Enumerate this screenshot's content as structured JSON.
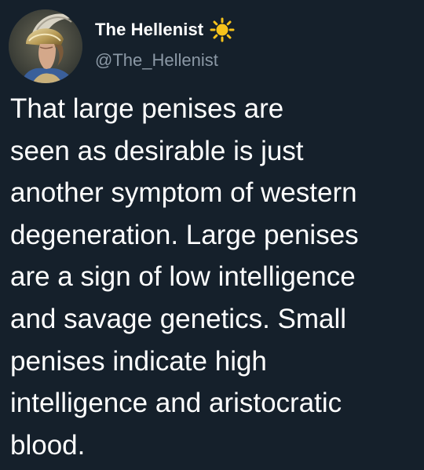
{
  "tweet": {
    "author": {
      "display_name": "The Hellenist",
      "handle": "@The_Hellenist",
      "badge_icon": "sun-emoji-icon",
      "avatar_icon": "greek-helmet-portrait-avatar"
    },
    "text": "That large penises are\nseen as desirable is just\nanother symptom of western\ndegeneration.  Large penises\nare a sign of low intelligence\nand savage genetics.  Small\npenises indicate high\nintelligence and aristocratic\nblood."
  },
  "colors": {
    "background": "#15202b",
    "text_primary": "#ffffff",
    "text_secondary": "#8b98a5",
    "sun": "#f7c31b"
  }
}
